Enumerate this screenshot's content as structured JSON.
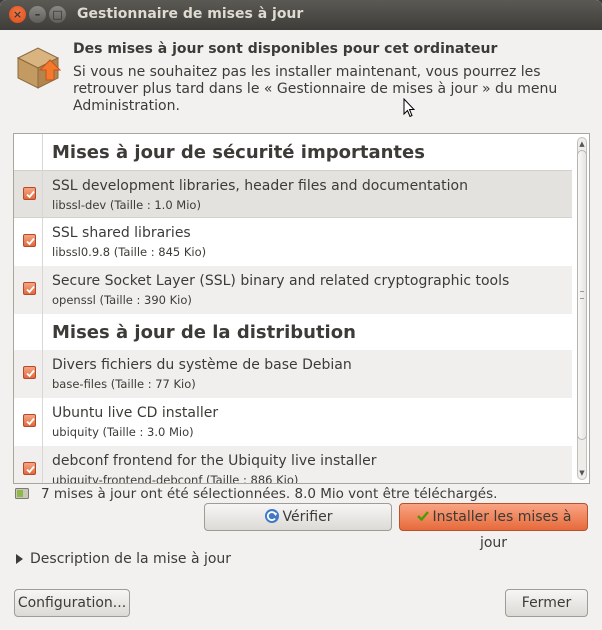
{
  "window": {
    "title": "Gestionnaire de mises à jour",
    "close_glyph": "×",
    "minimize_glyph": "–",
    "maximize_glyph": "□"
  },
  "header": {
    "icon": "package-upgrade-icon",
    "title": "Des mises à jour sont disponibles pour cet ordinateur",
    "text": "Si vous ne souhaitez pas les installer maintenant, vous pourrez les retrouver plus tard dans le « Gestionnaire de mises à jour » du menu Administration."
  },
  "groups": [
    {
      "label": "Mises à jour de sécurité importantes",
      "items": [
        {
          "name": "SSL development libraries, header files and documentation",
          "package": "libssl-dev (Taille : 1.0 Mio)",
          "checked": true
        },
        {
          "name": "SSL shared libraries",
          "package": "libssl0.9.8 (Taille : 845 Kio)",
          "checked": true
        },
        {
          "name": "Secure Socket Layer (SSL) binary and related cryptographic tools",
          "package": "openssl (Taille : 390 Kio)",
          "checked": true
        }
      ]
    },
    {
      "label": "Mises à jour de la distribution",
      "items": [
        {
          "name": "Divers fichiers du système de base Debian",
          "package": "base-files (Taille : 77 Kio)",
          "checked": true
        },
        {
          "name": "Ubuntu live CD installer",
          "package": "ubiquity (Taille : 3.0 Mio)",
          "checked": true
        },
        {
          "name": "debconf frontend for the Ubiquity live installer",
          "package": "ubiquity-frontend-debconf (Taille : 886 Kio)",
          "checked": true
        }
      ]
    }
  ],
  "status": {
    "text": "7 mises à jour ont été sélectionnées. 8.0 Mio vont être téléchargés."
  },
  "buttons": {
    "verify": "Vérifier",
    "install": "Installer les mises à jour",
    "configuration": "Configuration...",
    "close": "Fermer"
  },
  "description": {
    "label": "Description de la mise à jour",
    "expanded": false
  },
  "colors": {
    "accent": "#e66a3b",
    "titlebar": "#3c3b37",
    "window_bg": "#f2f1f0"
  }
}
